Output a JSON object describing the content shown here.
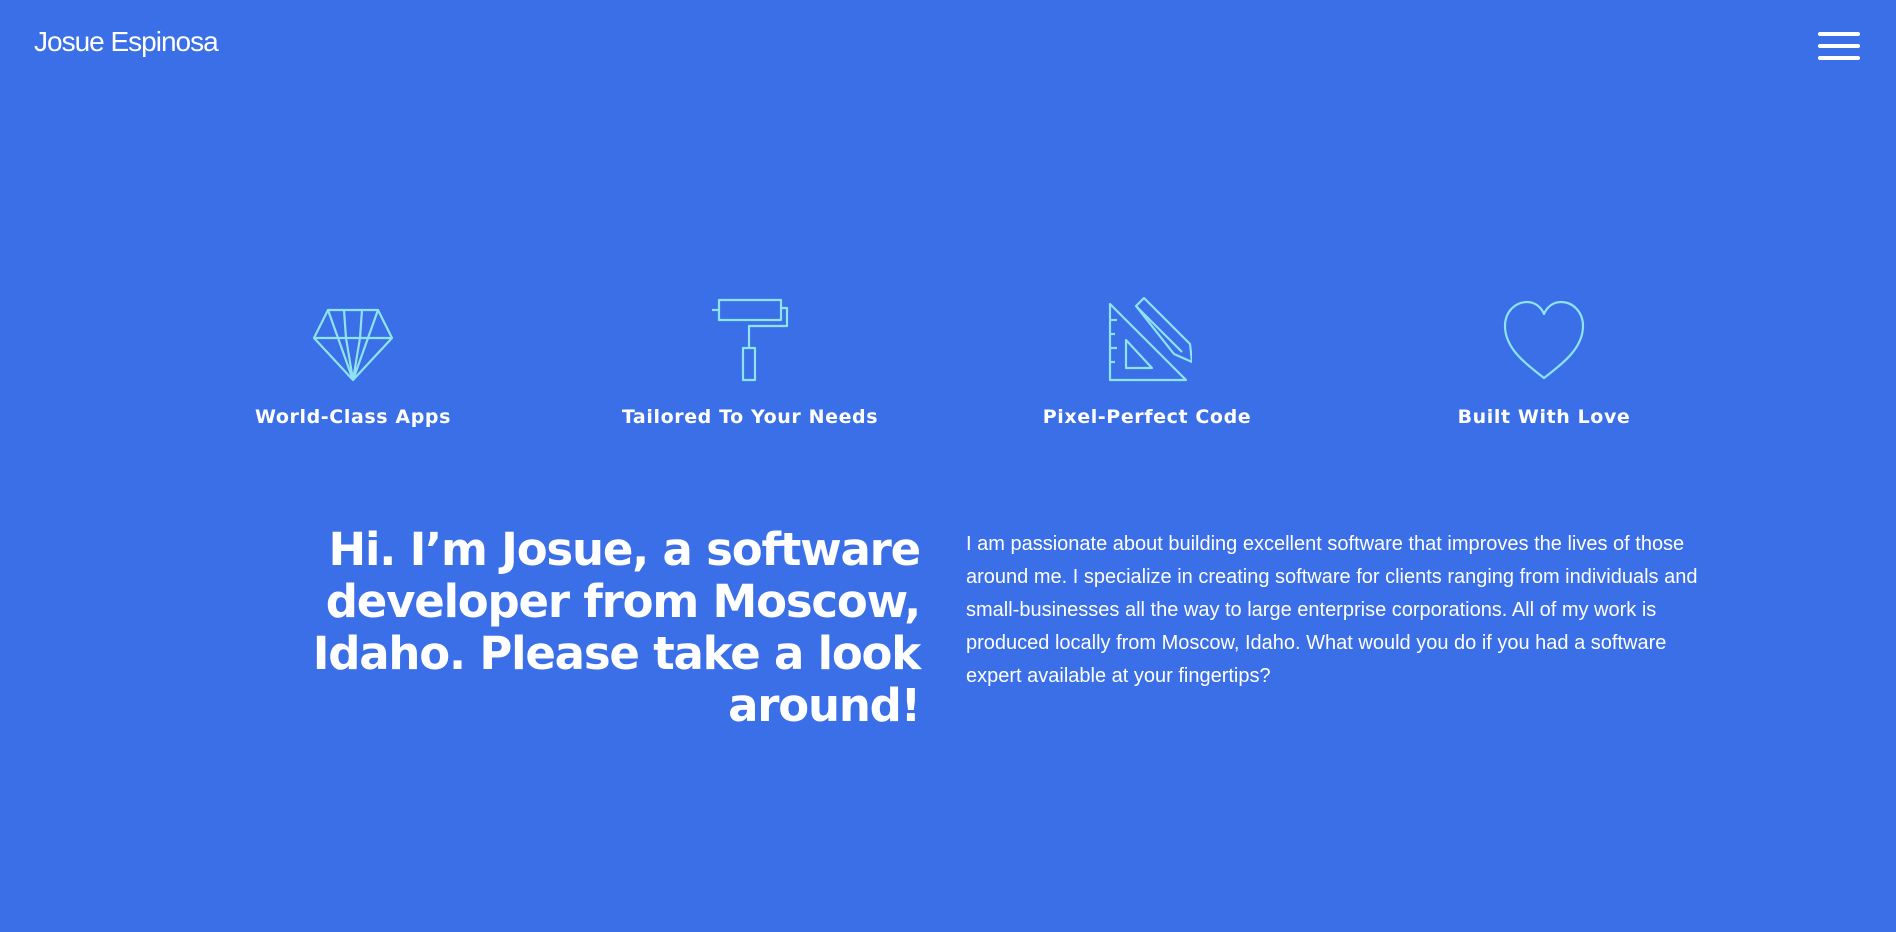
{
  "header": {
    "brand": "Josue Espinosa",
    "menu_icon": "hamburger-menu-icon"
  },
  "colors": {
    "background": "#3a6fe8",
    "icon_stroke": "#8fe3ef",
    "text": "#ffffff"
  },
  "features": [
    {
      "icon": "diamond-icon",
      "title": "World-Class Apps"
    },
    {
      "icon": "paint-roller-icon",
      "title": "Tailored To Your Needs"
    },
    {
      "icon": "ruler-pencil-icon",
      "title": "Pixel-Perfect Code"
    },
    {
      "icon": "heart-icon",
      "title": "Built With Love"
    }
  ],
  "intro": {
    "heading": "Hi. I’m Josue, a software developer from Moscow, Idaho. Please take a look around!",
    "paragraph": "I am passionate about building excellent software that improves the lives of those around me. I specialize in creating software for clients ranging from individuals and small-businesses all the way to large enterprise corporations. All of my work is produced locally from Moscow, Idaho. What would you do if you had a software expert available at your fingertips?"
  }
}
